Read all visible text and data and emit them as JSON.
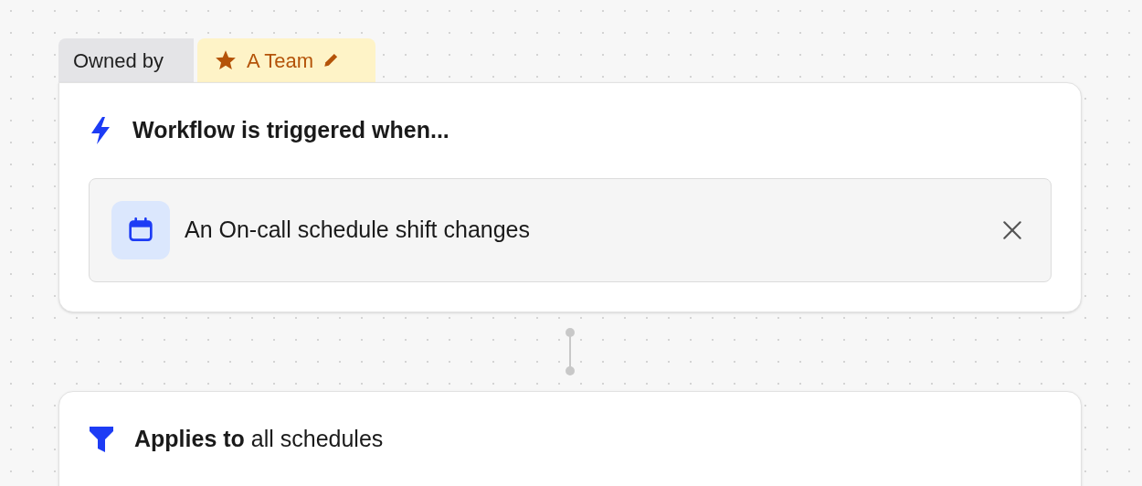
{
  "ownership": {
    "label": "Owned by",
    "team": "A Team"
  },
  "trigger_card": {
    "title": "Workflow is triggered when...",
    "trigger": {
      "label": "An On-call schedule shift changes"
    }
  },
  "condition_card": {
    "title": "**Applies to** all schedules"
  }
}
